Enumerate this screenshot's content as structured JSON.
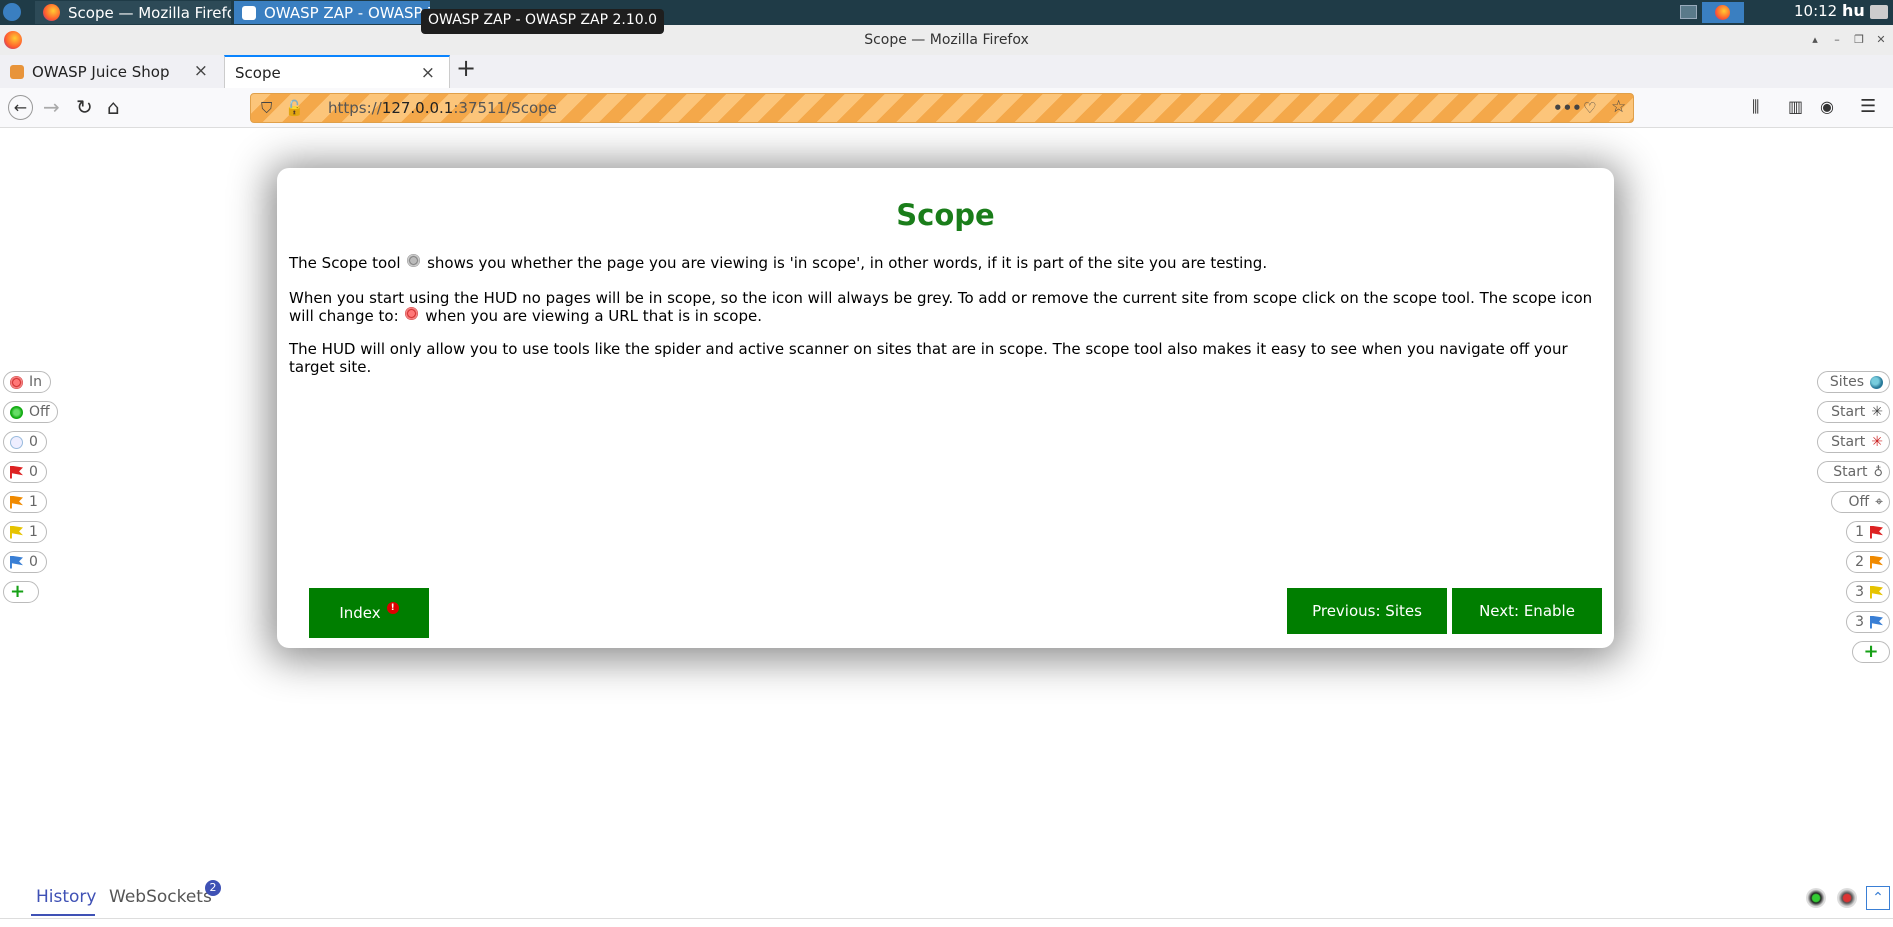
{
  "taskbar": {
    "task1_label": "Scope — Mozilla Firefox",
    "task2_label": "OWASP ZAP - OWASP Z...",
    "tooltip": "OWASP ZAP - OWASP ZAP 2.10.0",
    "clock": "10:12",
    "keyboard_layout": "hu"
  },
  "window": {
    "title": "Scope — Mozilla Firefox"
  },
  "tabs": [
    {
      "label": "OWASP Juice Shop"
    },
    {
      "label": "Scope"
    }
  ],
  "url": {
    "prefix": "https://",
    "host": "127.0.0.1",
    "rest": ":37511/Scope"
  },
  "modal": {
    "title": "Scope",
    "p1a": "The Scope tool",
    "p1b": "shows you whether the page you are viewing is 'in scope', in other words, if it is part of the site you are testing.",
    "p2a": "When you start using the HUD no pages will be in scope, so the icon will always be grey. To add or remove the current site from scope click on the scope tool. The scope icon will change to:",
    "p2b": "when you are viewing a URL that is in scope.",
    "p3": "The HUD will only allow you to use tools like the spider and active scanner on sites that are in scope. The scope tool also makes it easy to see when you navigate off your target site.",
    "index_label": "Index",
    "prev_label": "Previous: Sites",
    "next_label": "Next: Enable"
  },
  "hud_left": [
    {
      "label": "In",
      "icon": "scope-icon"
    },
    {
      "label": "Off",
      "icon": "break-icon"
    },
    {
      "label": "0",
      "icon": "lightbulb-icon"
    },
    {
      "label": "0",
      "icon": "high-alert-flag-icon"
    },
    {
      "label": "1",
      "icon": "medium-alert-flag-icon"
    },
    {
      "label": "1",
      "icon": "low-alert-flag-icon"
    },
    {
      "label": "0",
      "icon": "info-alert-flag-icon"
    }
  ],
  "hud_right": [
    {
      "label": "Sites",
      "icon": "globe-icon"
    },
    {
      "label": "Start",
      "icon": "spider-icon"
    },
    {
      "label": "Start",
      "icon": "ajax-spider-icon"
    },
    {
      "label": "Start",
      "icon": "active-scan-icon"
    },
    {
      "label": "Off",
      "icon": "attack-mode-icon"
    },
    {
      "label": "1",
      "icon": "high-alert-flag-icon"
    },
    {
      "label": "2",
      "icon": "medium-alert-flag-icon"
    },
    {
      "label": "3",
      "icon": "low-alert-flag-icon"
    },
    {
      "label": "3",
      "icon": "info-alert-flag-icon"
    }
  ],
  "bottom": {
    "history_label": "History",
    "websockets_label": "WebSockets",
    "websockets_count": "2"
  },
  "colors": {
    "accent_green": "#007e00",
    "title_green": "#1a7d1a",
    "tab_blue": "#3f51b5"
  }
}
